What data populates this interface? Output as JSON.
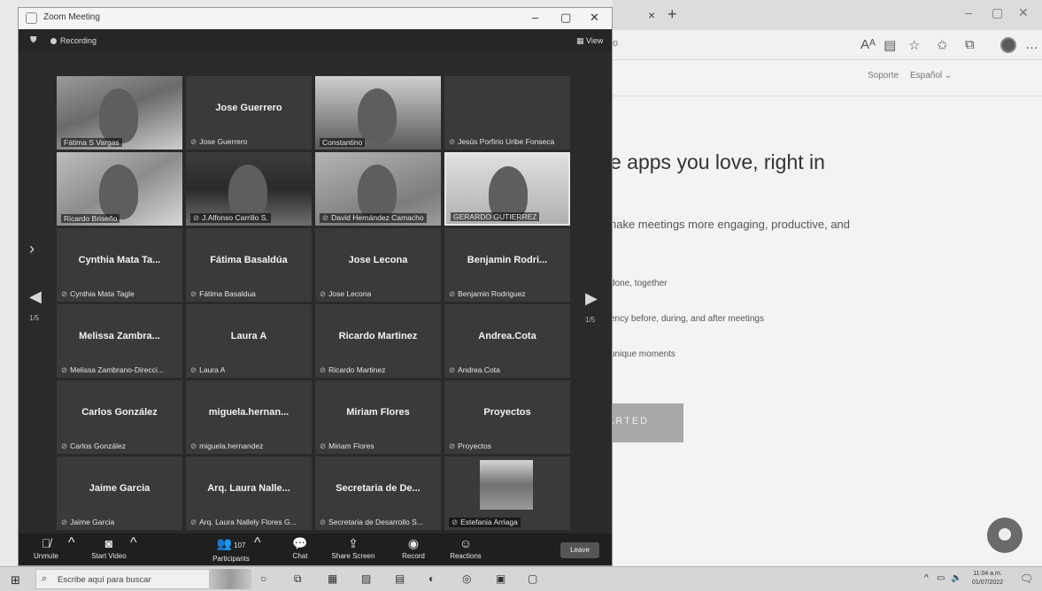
{
  "browser": {
    "tab_close": "×",
    "new_tab": "+",
    "address_tail": "o",
    "toolbar_icons": [
      "read-aloud-icon",
      "reading-view-icon",
      "favorite-icon",
      "favorites-icon",
      "collections-icon",
      "profile-icon",
      "more-icon"
    ],
    "nav": {
      "support": "Soporte",
      "language": "Español ⌄"
    },
    "hero_heading": "e apps you love, right in",
    "hero_sub": "nake meetings more engaging, productive, and",
    "bullets": [
      "done, together",
      "ency before, during, and after meetings",
      "unique moments"
    ],
    "cta_label": "ARTED"
  },
  "zoom": {
    "window_title": "Zoom Meeting",
    "recording_label": "Recording",
    "view_label": "View",
    "page_indicator": "1/5",
    "tiles": [
      {
        "display": "",
        "label": "Fátima S Vargas",
        "video": true,
        "style": "video-1"
      },
      {
        "display": "Jose Guerrero",
        "label": "Jose Guerrero",
        "video": false
      },
      {
        "display": "",
        "label": "Constantino",
        "video": true,
        "style": "video-2"
      },
      {
        "display": "",
        "label": "Jesús Porfirio Uribe Fonseca",
        "video": false
      },
      {
        "display": "",
        "label": "Ricardo Briseño",
        "video": true,
        "style": "video-3"
      },
      {
        "display": "",
        "label": "J.Alfonso Carrillo S.",
        "video": true,
        "style": "video-4"
      },
      {
        "display": "",
        "label": "David Hernández Camacho",
        "video": true,
        "style": "video-5"
      },
      {
        "display": "",
        "label": "GERARDO GUTIERREZ",
        "video": true,
        "style": "video-6"
      },
      {
        "display": "Cynthia Mata Ta...",
        "label": "Cynthia Mata Tagle",
        "video": false
      },
      {
        "display": "Fátima Basaldúa",
        "label": "Fátima Basaldua",
        "video": false
      },
      {
        "display": "Jose Lecona",
        "label": "Jose Lecona",
        "video": false
      },
      {
        "display": "Benjamin Rodri...",
        "label": "Benjamin Rodriguez",
        "video": false
      },
      {
        "display": "Melissa Zambra...",
        "label": "Melissa Zambrano-Direcci...",
        "video": false
      },
      {
        "display": "Laura A",
        "label": "Laura A",
        "video": false
      },
      {
        "display": "Ricardo Martinez",
        "label": "Ricardo Martinez",
        "video": false
      },
      {
        "display": "Andrea.Cota",
        "label": "Andrea.Cota",
        "video": false
      },
      {
        "display": "Carlos González",
        "label": "Carlos González",
        "video": false
      },
      {
        "display": "miguela.hernan...",
        "label": "miguela.hernandez",
        "video": false
      },
      {
        "display": "Miriam Flores",
        "label": "Miriam Flores",
        "video": false
      },
      {
        "display": "Proyectos",
        "label": "Proyectos",
        "video": false
      },
      {
        "display": "Jaime Garcia",
        "label": "Jaime Garcia",
        "video": false
      },
      {
        "display": "Arq. Laura Nalle...",
        "label": "Arq. Laura Nallely Flores G...",
        "video": false
      },
      {
        "display": "Secretaria de De...",
        "label": "Secretaria de Desarrollo S...",
        "video": false
      },
      {
        "display": "",
        "label": "Estefania Arriaga",
        "video": true,
        "style": "video-7",
        "avatar": true
      }
    ],
    "toolbar": {
      "unmute": "Unmute",
      "start_video": "Start Video",
      "participants": "Participants",
      "participants_count": "107",
      "chat": "Chat",
      "share_screen": "Share Screen",
      "record": "Record",
      "reactions": "Reactions",
      "leave": "Leave"
    }
  },
  "taskbar": {
    "search_placeholder": "Escribe aquí para buscar",
    "clock_time": "11:04 a.m.",
    "clock_date": "01/07/2022"
  }
}
